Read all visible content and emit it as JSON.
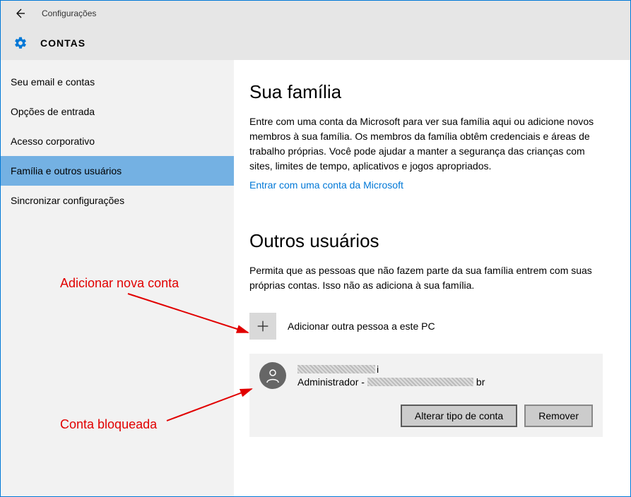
{
  "header": {
    "config_label": "Configurações",
    "title": "CONTAS"
  },
  "sidebar": {
    "items": [
      {
        "label": "Seu email e contas"
      },
      {
        "label": "Opções de entrada"
      },
      {
        "label": "Acesso corporativo"
      },
      {
        "label": "Família e outros usuários"
      },
      {
        "label": "Sincronizar configurações"
      }
    ]
  },
  "main": {
    "family": {
      "title": "Sua família",
      "desc": "Entre com uma conta da Microsoft para ver sua família aqui ou adicione novos membros à sua família. Os membros da família obtêm credenciais e áreas de trabalho próprias. Você pode ajudar a manter a segurança das crianças com sites, limites de tempo, aplicativos e jogos apropriados.",
      "signin_link": "Entrar com uma conta da Microsoft"
    },
    "others": {
      "title": "Outros usuários",
      "desc": "Permita que as pessoas que não fazem parte da sua família entrem com suas próprias contas. Isso não as adiciona à sua família.",
      "add_label": "Adicionar outra pessoa a este PC",
      "user": {
        "name_suffix": "i",
        "role_prefix": "Administrador - ",
        "email_suffix": "br",
        "change_type": "Alterar tipo de conta",
        "remove": "Remover"
      }
    }
  },
  "annotations": {
    "add_new_account": "Adicionar nova conta",
    "blocked_account": "Conta bloqueada"
  }
}
